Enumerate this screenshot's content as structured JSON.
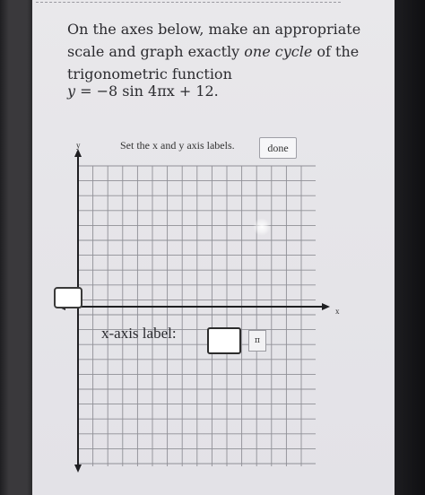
{
  "instruction": {
    "line1": "On the axes below, make an appropriate",
    "line2_pre": "scale and graph exactly ",
    "line2_em": "one cycle",
    "line2_post": " of the",
    "line3": "trigonometric function"
  },
  "equation": {
    "lhs": "y",
    "rhs": " = −8 sin 4πx + 12."
  },
  "graph": {
    "set_labels_text": "Set the x and y axis labels.",
    "done_label": "done",
    "y_axis_letter": "y",
    "x_axis_letter": "x",
    "x_axis_label_text": "x-axis label:",
    "pi_button_label": "π"
  }
}
